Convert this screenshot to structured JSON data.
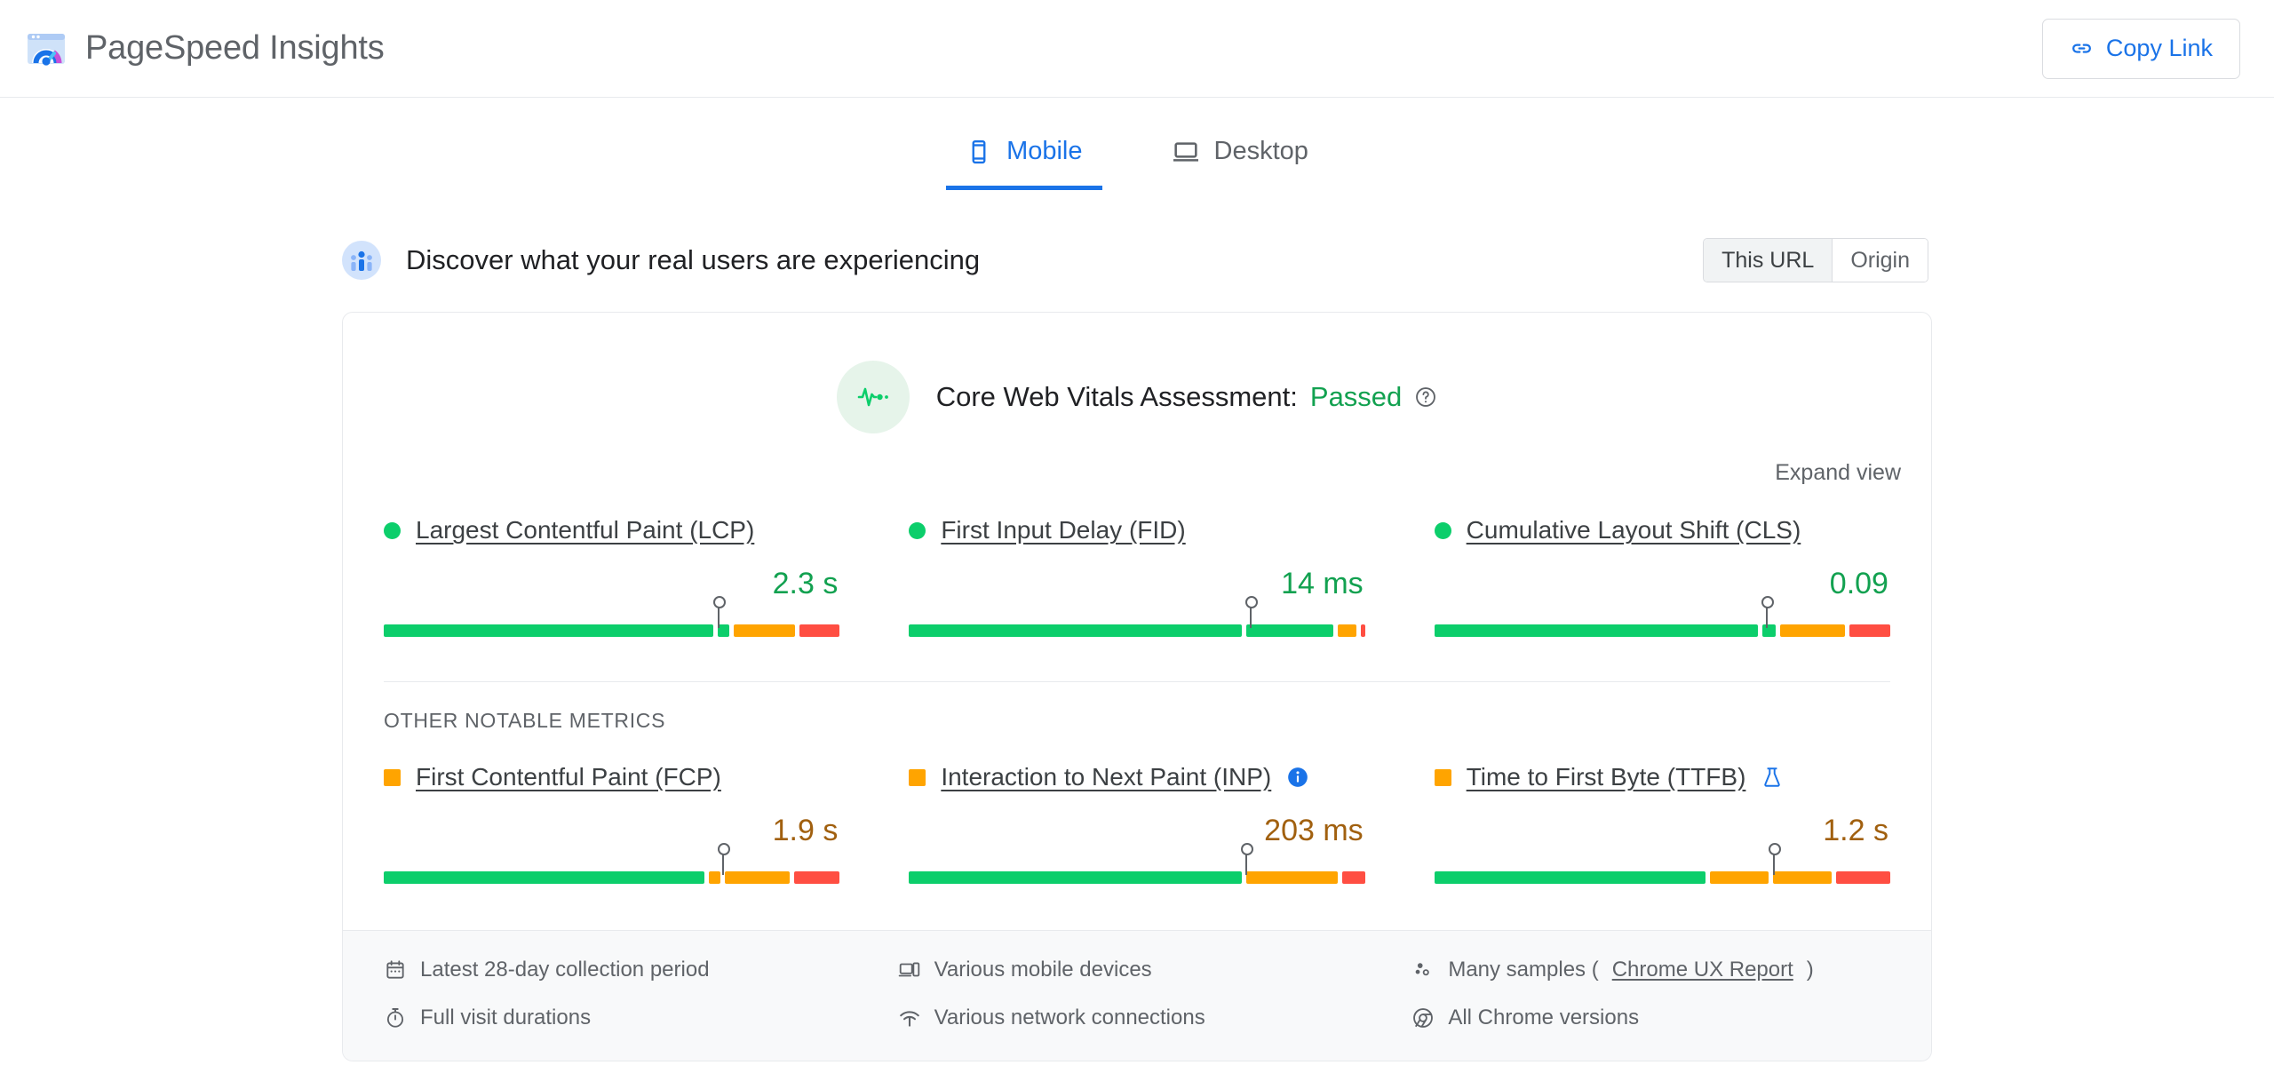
{
  "header": {
    "title": "PageSpeed Insights",
    "logo_icon": "pagespeed-logo-icon",
    "copy_link_label": "Copy Link",
    "copy_link_icon": "link-icon",
    "accent_color": "#1a73e8"
  },
  "form_factor_tabs": [
    {
      "label": "Mobile",
      "icon": "mobile-phone-icon",
      "active": true
    },
    {
      "label": "Desktop",
      "icon": "desktop-monitor-icon",
      "active": false
    }
  ],
  "field_section": {
    "heading": "Discover what your real users are experiencing",
    "heading_icon": "users-group-icon",
    "scope_options": [
      {
        "label": "This URL",
        "selected": true
      },
      {
        "label": "Origin",
        "selected": false
      }
    ]
  },
  "assessment": {
    "icon": "pulse-heartbeat-icon",
    "label": "Core Web Vitals Assessment:",
    "verdict": "Passed",
    "verdict_color": "#12a150",
    "help_icon": "help-circle-icon",
    "expand_view_label": "Expand view"
  },
  "core_web_vitals": [
    {
      "name": "Largest Contentful Paint (LCP)",
      "marker": "dot",
      "marker_color": "#0cce6b",
      "value": "2.3 s",
      "rating": "good",
      "pin_percent": 73.5,
      "segments": [
        {
          "rating": "good",
          "percent": 73.0
        },
        {
          "rating": "good",
          "percent": 2.5
        },
        {
          "rating": "avg",
          "percent": 13.5
        },
        {
          "rating": "poor",
          "percent": 9.0
        }
      ]
    },
    {
      "name": "First Input Delay (FID)",
      "marker": "dot",
      "marker_color": "#0cce6b",
      "value": "14 ms",
      "rating": "good",
      "pin_percent": 75.0,
      "segments": [
        {
          "rating": "good",
          "percent": 74.0
        },
        {
          "rating": "good",
          "percent": 19.5
        },
        {
          "rating": "avg",
          "percent": 4.0
        },
        {
          "rating": "poor",
          "percent": 1.0
        }
      ]
    },
    {
      "name": "Cumulative Layout Shift (CLS)",
      "marker": "dot",
      "marker_color": "#0cce6b",
      "value": "0.09",
      "rating": "good",
      "pin_percent": 73.0,
      "segments": [
        {
          "rating": "good",
          "percent": 72.0
        },
        {
          "rating": "good",
          "percent": 3.0
        },
        {
          "rating": "avg",
          "percent": 14.5
        },
        {
          "rating": "poor",
          "percent": 9.0
        }
      ]
    }
  ],
  "other_metrics_label": "OTHER NOTABLE METRICS",
  "other_metrics": [
    {
      "name": "First Contentful Paint (FCP)",
      "marker": "square",
      "marker_color": "#ffa400",
      "value": "1.9 s",
      "rating": "avg",
      "pin_percent": 74.5,
      "badge": null,
      "segments": [
        {
          "rating": "good",
          "percent": 71.0
        },
        {
          "rating": "avg",
          "percent": 2.5
        },
        {
          "rating": "avg",
          "percent": 14.5
        },
        {
          "rating": "poor",
          "percent": 10.0
        }
      ]
    },
    {
      "name": "Interaction to Next Paint (INP)",
      "marker": "square",
      "marker_color": "#ffa400",
      "value": "203 ms",
      "rating": "avg",
      "pin_percent": 74.0,
      "badge": "info-icon",
      "segments": [
        {
          "rating": "good",
          "percent": 73.0
        },
        {
          "rating": "avg",
          "percent": 20.0
        },
        {
          "rating": "poor",
          "percent": 5.0
        }
      ]
    },
    {
      "name": "Time to First Byte (TTFB)",
      "marker": "square",
      "marker_color": "#ffa400",
      "value": "1.2 s",
      "rating": "avg",
      "pin_percent": 74.5,
      "badge": "experiment-flask-icon",
      "segments": [
        {
          "rating": "good",
          "percent": 60.0
        },
        {
          "rating": "avg",
          "percent": 13.0
        },
        {
          "rating": "avg",
          "percent": 13.0
        },
        {
          "rating": "poor",
          "percent": 12.0
        }
      ]
    }
  ],
  "footer_columns": [
    [
      {
        "icon": "calendar-icon",
        "text": "Latest 28-day collection period"
      },
      {
        "icon": "stopwatch-icon",
        "text": "Full visit durations"
      }
    ],
    [
      {
        "icon": "devices-icon",
        "text": "Various mobile devices"
      },
      {
        "icon": "network-signal-icon",
        "text": "Various network connections"
      }
    ],
    [
      {
        "icon": "samples-dots-icon",
        "text": "Many samples (",
        "link": "Chrome UX Report",
        "text_after": ")"
      },
      {
        "icon": "chrome-icon",
        "text": "All Chrome versions"
      }
    ]
  ]
}
